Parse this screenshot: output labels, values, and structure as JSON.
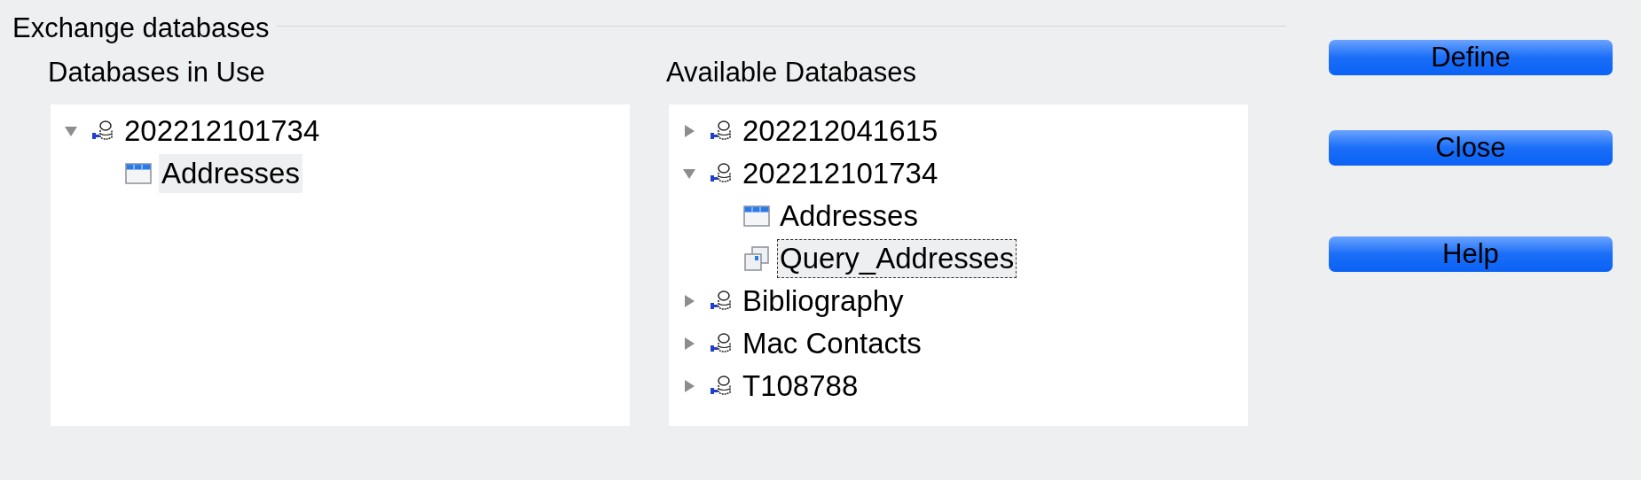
{
  "frame": {
    "title": "Exchange databases"
  },
  "in_use": {
    "label": "Databases in Use",
    "items": [
      {
        "kind": "database",
        "label": "202212101734",
        "expanded": true,
        "selected": false,
        "focused": false,
        "children": [
          {
            "kind": "table",
            "label": "Addresses",
            "selected": true,
            "focused": false
          }
        ]
      }
    ]
  },
  "available": {
    "label": "Available Databases",
    "items": [
      {
        "kind": "database",
        "label": "202212041615",
        "expanded": false,
        "selected": false,
        "focused": false
      },
      {
        "kind": "database",
        "label": "202212101734",
        "expanded": true,
        "selected": false,
        "focused": false,
        "children": [
          {
            "kind": "table",
            "label": "Addresses",
            "selected": false,
            "focused": false
          },
          {
            "kind": "query",
            "label": "Query_Addresses",
            "selected": true,
            "focused": true
          }
        ]
      },
      {
        "kind": "database",
        "label": "Bibliography",
        "expanded": false,
        "selected": false,
        "focused": false
      },
      {
        "kind": "database",
        "label": "Mac Contacts",
        "expanded": false,
        "selected": false,
        "focused": false
      },
      {
        "kind": "database",
        "label": "T108788",
        "expanded": false,
        "selected": false,
        "focused": false
      }
    ]
  },
  "buttons": [
    {
      "label": "Define"
    },
    {
      "label": "Close"
    },
    {
      "label": "Help"
    }
  ]
}
